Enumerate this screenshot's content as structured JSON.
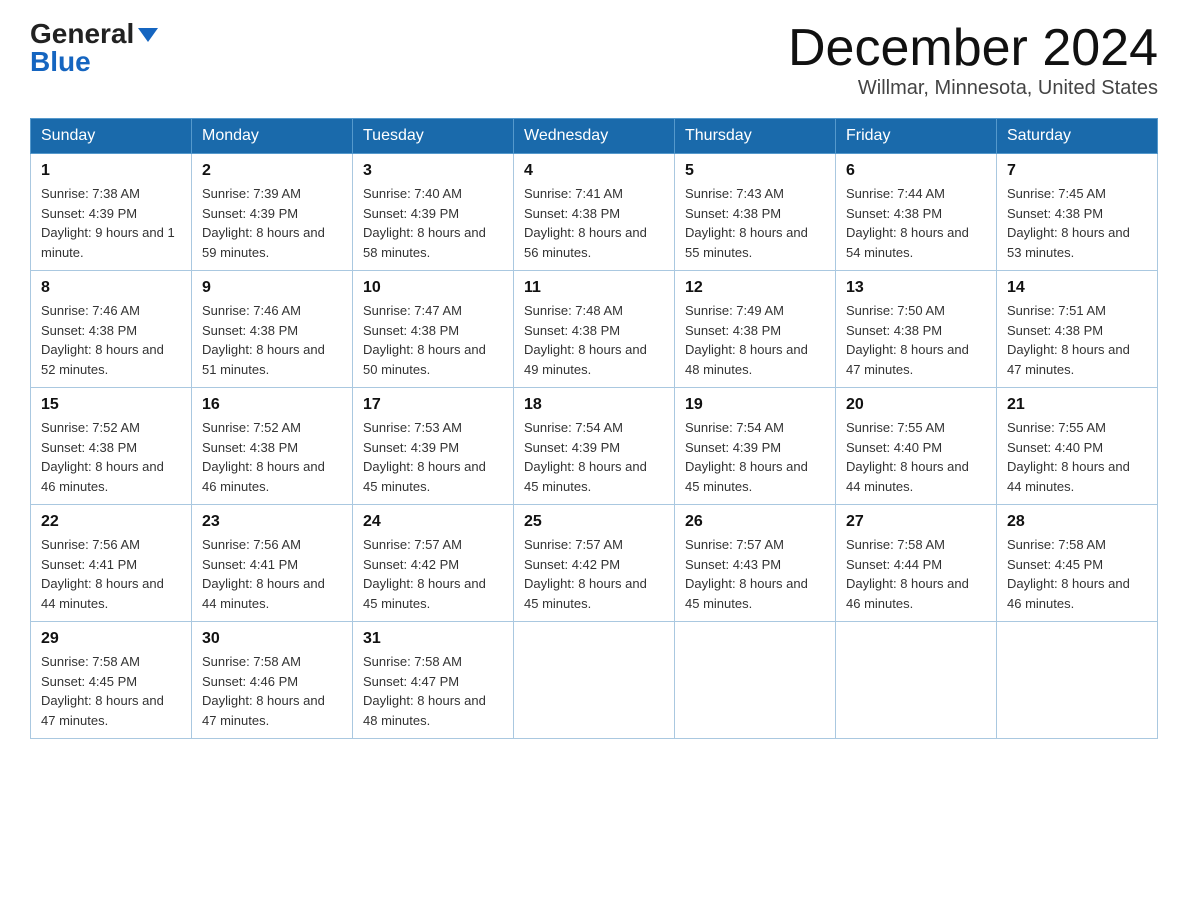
{
  "header": {
    "logo_text_general": "General",
    "logo_text_blue": "Blue",
    "title": "December 2024",
    "location": "Willmar, Minnesota, United States"
  },
  "days_of_week": [
    "Sunday",
    "Monday",
    "Tuesday",
    "Wednesday",
    "Thursday",
    "Friday",
    "Saturday"
  ],
  "weeks": [
    [
      {
        "day": "1",
        "sunrise": "7:38 AM",
        "sunset": "4:39 PM",
        "daylight": "9 hours and 1 minute."
      },
      {
        "day": "2",
        "sunrise": "7:39 AM",
        "sunset": "4:39 PM",
        "daylight": "8 hours and 59 minutes."
      },
      {
        "day": "3",
        "sunrise": "7:40 AM",
        "sunset": "4:39 PM",
        "daylight": "8 hours and 58 minutes."
      },
      {
        "day": "4",
        "sunrise": "7:41 AM",
        "sunset": "4:38 PM",
        "daylight": "8 hours and 56 minutes."
      },
      {
        "day": "5",
        "sunrise": "7:43 AM",
        "sunset": "4:38 PM",
        "daylight": "8 hours and 55 minutes."
      },
      {
        "day": "6",
        "sunrise": "7:44 AM",
        "sunset": "4:38 PM",
        "daylight": "8 hours and 54 minutes."
      },
      {
        "day": "7",
        "sunrise": "7:45 AM",
        "sunset": "4:38 PM",
        "daylight": "8 hours and 53 minutes."
      }
    ],
    [
      {
        "day": "8",
        "sunrise": "7:46 AM",
        "sunset": "4:38 PM",
        "daylight": "8 hours and 52 minutes."
      },
      {
        "day": "9",
        "sunrise": "7:46 AM",
        "sunset": "4:38 PM",
        "daylight": "8 hours and 51 minutes."
      },
      {
        "day": "10",
        "sunrise": "7:47 AM",
        "sunset": "4:38 PM",
        "daylight": "8 hours and 50 minutes."
      },
      {
        "day": "11",
        "sunrise": "7:48 AM",
        "sunset": "4:38 PM",
        "daylight": "8 hours and 49 minutes."
      },
      {
        "day": "12",
        "sunrise": "7:49 AM",
        "sunset": "4:38 PM",
        "daylight": "8 hours and 48 minutes."
      },
      {
        "day": "13",
        "sunrise": "7:50 AM",
        "sunset": "4:38 PM",
        "daylight": "8 hours and 47 minutes."
      },
      {
        "day": "14",
        "sunrise": "7:51 AM",
        "sunset": "4:38 PM",
        "daylight": "8 hours and 47 minutes."
      }
    ],
    [
      {
        "day": "15",
        "sunrise": "7:52 AM",
        "sunset": "4:38 PM",
        "daylight": "8 hours and 46 minutes."
      },
      {
        "day": "16",
        "sunrise": "7:52 AM",
        "sunset": "4:38 PM",
        "daylight": "8 hours and 46 minutes."
      },
      {
        "day": "17",
        "sunrise": "7:53 AM",
        "sunset": "4:39 PM",
        "daylight": "8 hours and 45 minutes."
      },
      {
        "day": "18",
        "sunrise": "7:54 AM",
        "sunset": "4:39 PM",
        "daylight": "8 hours and 45 minutes."
      },
      {
        "day": "19",
        "sunrise": "7:54 AM",
        "sunset": "4:39 PM",
        "daylight": "8 hours and 45 minutes."
      },
      {
        "day": "20",
        "sunrise": "7:55 AM",
        "sunset": "4:40 PM",
        "daylight": "8 hours and 44 minutes."
      },
      {
        "day": "21",
        "sunrise": "7:55 AM",
        "sunset": "4:40 PM",
        "daylight": "8 hours and 44 minutes."
      }
    ],
    [
      {
        "day": "22",
        "sunrise": "7:56 AM",
        "sunset": "4:41 PM",
        "daylight": "8 hours and 44 minutes."
      },
      {
        "day": "23",
        "sunrise": "7:56 AM",
        "sunset": "4:41 PM",
        "daylight": "8 hours and 44 minutes."
      },
      {
        "day": "24",
        "sunrise": "7:57 AM",
        "sunset": "4:42 PM",
        "daylight": "8 hours and 45 minutes."
      },
      {
        "day": "25",
        "sunrise": "7:57 AM",
        "sunset": "4:42 PM",
        "daylight": "8 hours and 45 minutes."
      },
      {
        "day": "26",
        "sunrise": "7:57 AM",
        "sunset": "4:43 PM",
        "daylight": "8 hours and 45 minutes."
      },
      {
        "day": "27",
        "sunrise": "7:58 AM",
        "sunset": "4:44 PM",
        "daylight": "8 hours and 46 minutes."
      },
      {
        "day": "28",
        "sunrise": "7:58 AM",
        "sunset": "4:45 PM",
        "daylight": "8 hours and 46 minutes."
      }
    ],
    [
      {
        "day": "29",
        "sunrise": "7:58 AM",
        "sunset": "4:45 PM",
        "daylight": "8 hours and 47 minutes."
      },
      {
        "day": "30",
        "sunrise": "7:58 AM",
        "sunset": "4:46 PM",
        "daylight": "8 hours and 47 minutes."
      },
      {
        "day": "31",
        "sunrise": "7:58 AM",
        "sunset": "4:47 PM",
        "daylight": "8 hours and 48 minutes."
      },
      null,
      null,
      null,
      null
    ]
  ]
}
